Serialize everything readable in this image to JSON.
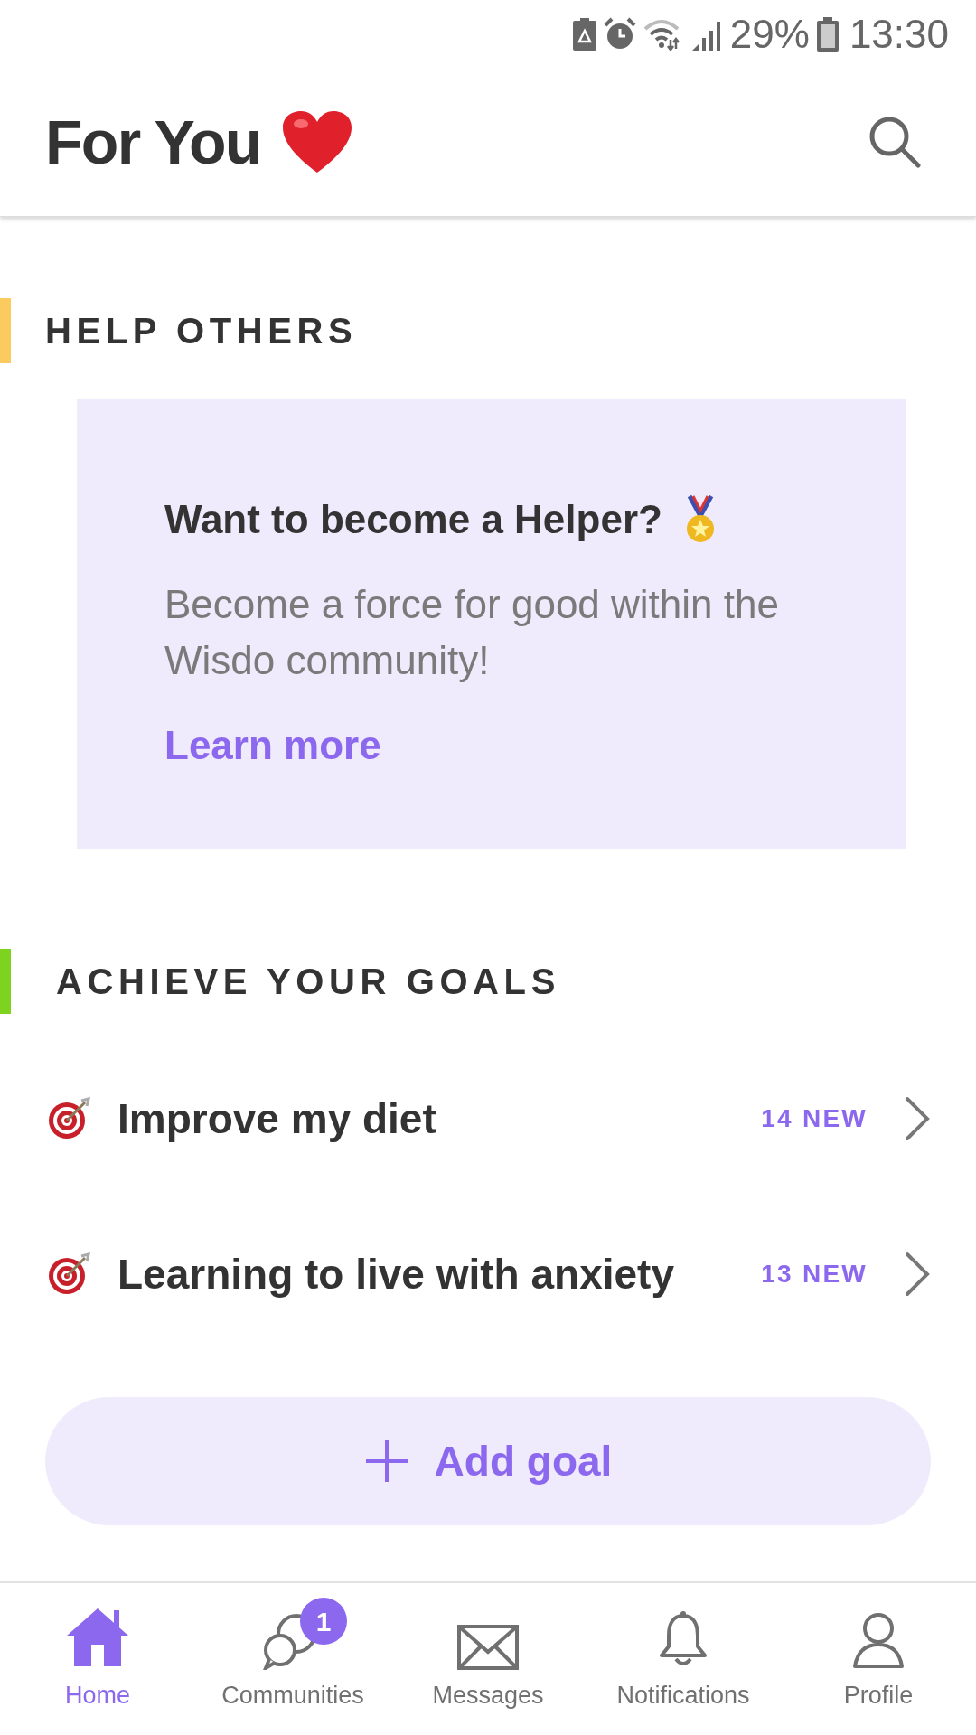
{
  "status_bar": {
    "battery": "29%",
    "time": "13:30"
  },
  "header": {
    "title": "For You"
  },
  "sections": [
    {
      "kind": "card",
      "heading": "HELP OTHERS",
      "color": "#fccb5f",
      "card": {
        "title": "Want to become a Helper?",
        "body": "Become a force for good within the Wisdo community!",
        "link": "Learn more"
      }
    },
    {
      "kind": "goals",
      "heading": "ACHIEVE YOUR GOALS",
      "color": "#7ed321",
      "goals": [
        {
          "title": "Improve my diet",
          "badge": "14 NEW"
        },
        {
          "title": "Learning to live with anxiety",
          "badge": "13 NEW"
        }
      ],
      "add_button": "Add goal"
    }
  ],
  "nav": [
    {
      "label": "Home",
      "selected": true
    },
    {
      "label": "Communities",
      "selected": false,
      "badge": "1"
    },
    {
      "label": "Messages",
      "selected": false
    },
    {
      "label": "Notifications",
      "selected": false
    },
    {
      "label": "Profile",
      "selected": false
    }
  ]
}
